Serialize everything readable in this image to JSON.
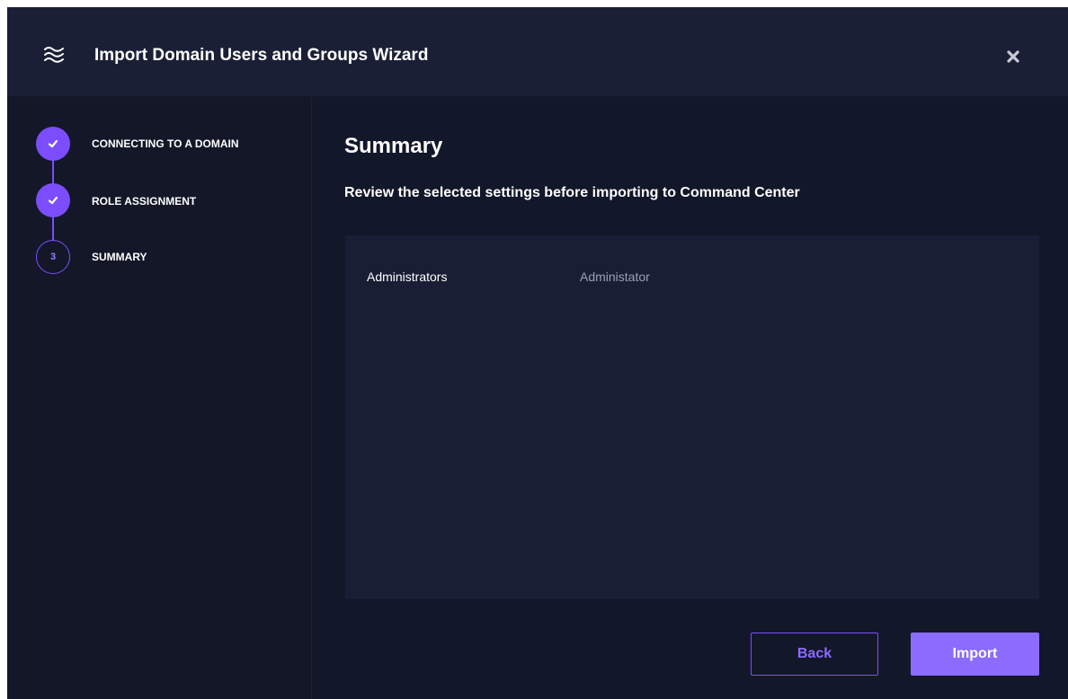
{
  "header": {
    "title": "Import Domain Users and Groups Wizard",
    "icon": "waves-icon",
    "close_icon": "close-icon"
  },
  "steps": [
    {
      "label": "CONNECTING TO A DOMAIN",
      "state": "done",
      "icon": "check-icon"
    },
    {
      "label": "ROLE ASSIGNMENT",
      "state": "done",
      "icon": "check-icon"
    },
    {
      "label": "SUMMARY",
      "state": "current",
      "number": "3"
    }
  ],
  "main": {
    "title": "Summary",
    "subtitle": "Review the selected settings before importing to Command Center",
    "summary_rows": [
      {
        "group": "Administrators",
        "role": "Administator"
      }
    ]
  },
  "buttons": {
    "back": "Back",
    "import": "Import"
  },
  "colors": {
    "accent": "#7c4dff",
    "button_fill": "#8b6cff",
    "background": "#13172a",
    "header": "#1b1f36",
    "panel": "#1a1e35"
  }
}
